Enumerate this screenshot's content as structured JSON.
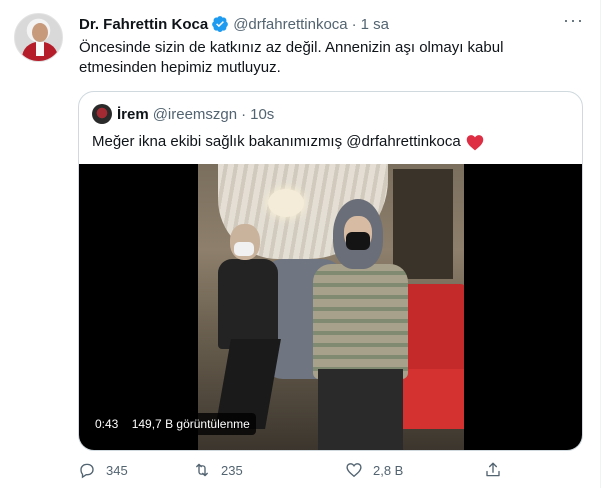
{
  "tweet": {
    "author_name": "Dr. Fahrettin Koca",
    "author_handle": "@drfahrettinkoca",
    "separator": "·",
    "timestamp": "1 sa",
    "text": "Öncesinde sizin de katkınız az değil. Annenizin aşı olmayı kabul etmesinden hepimiz mutluyuz."
  },
  "quoted_tweet": {
    "author_name": "İrem",
    "author_handle": "@ireemszgn",
    "separator": "·",
    "timestamp": "10s",
    "text": "Meğer ikna ekibi sağlık bakanımızmış @drfahrettinkoca",
    "emoji": "red-heart-icon",
    "video": {
      "duration": "0:43",
      "views": "149,7 B görüntülenme"
    }
  },
  "actions": {
    "replies": "345",
    "retweets": "235",
    "likes": "2,8 B"
  },
  "colors": {
    "text_primary": "#0f1419",
    "text_secondary": "#536471",
    "verified_blue": "#1d9bf0",
    "border": "#cfd9de",
    "heart_red": "#e0245e"
  }
}
